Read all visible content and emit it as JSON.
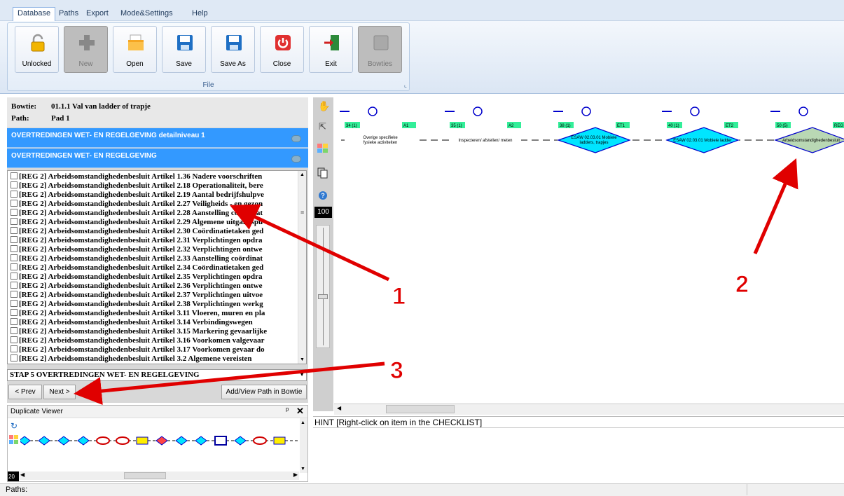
{
  "menu": {
    "tabs": [
      "Database",
      "Paths",
      "Export",
      "Mode&Settings",
      "Help"
    ]
  },
  "ribbon": {
    "buttons": [
      "Unlocked",
      "New",
      "Open",
      "Save",
      "Save As",
      "Close",
      "Exit",
      "Bowties"
    ],
    "group_label": "File"
  },
  "info": {
    "bowtie_label": "Bowtie:",
    "bowtie_value": "01.1.1 Val van ladder of trapje",
    "path_label": "Path:",
    "path_value": "Pad 1"
  },
  "bars": [
    "OVERTREDINGEN WET- EN REGELGEVING detailniveau 1",
    "OVERTREDINGEN WET- EN REGELGEVING"
  ],
  "checklist": {
    "items": [
      "[REG 2] Arbeidsomstandighedenbesluit Artikel 1.36 Nadere voorschriften",
      "[REG 2] Arbeidsomstandighedenbesluit Artikel 2.18 Operationaliteit, bere",
      "[REG 2] Arbeidsomstandighedenbesluit Artikel 2.19 Aantal bedrijfshulpve",
      "[REG 2] Arbeidsomstandighedenbesluit Artikel 2.27 Veiligheids - en gezon",
      "[REG 2] Arbeidsomstandighedenbesluit Artikel 2.28 Aanstelling coördinat",
      "[REG 2] Arbeidsomstandighedenbesluit Artikel 2.29 Algemene uitgangspu",
      "[REG 2] Arbeidsomstandighedenbesluit Artikel 2.30 Coördinatietaken ged",
      "[REG 2] Arbeidsomstandighedenbesluit Artikel 2.31 Verplichtingen opdra",
      "[REG 2] Arbeidsomstandighedenbesluit Artikel 2.32 Verplichtingen ontwe",
      "[REG 2] Arbeidsomstandighedenbesluit Artikel 2.33 Aanstelling coördinat",
      "[REG 2] Arbeidsomstandighedenbesluit Artikel 2.34 Coördinatietaken ged",
      "[REG 2] Arbeidsomstandighedenbesluit Artikel 2.35 Verplichtingen opdra",
      "[REG 2] Arbeidsomstandighedenbesluit Artikel 2.36 Verplichtingen ontwe",
      "[REG 2] Arbeidsomstandighedenbesluit Artikel 2.37 Verplichtingen uitvoe",
      "[REG 2] Arbeidsomstandighedenbesluit Artikel 2.38 Verplichtingen werkg",
      "[REG 2] Arbeidsomstandighedenbesluit Artikel 3.11 Vloeren, muren en pla",
      "[REG 2] Arbeidsomstandighedenbesluit Artikel 3.14 Verbindingswegen",
      "[REG 2] Arbeidsomstandighedenbesluit Artikel 3.15 Markering gevaarlijke",
      "[REG 2] Arbeidsomstandighedenbesluit Artikel 3.16 Voorkomen valgevaar",
      "[REG 2] Arbeidsomstandighedenbesluit Artikel 3.17 Voorkomen gevaar do",
      "[REG 2] Arbeidsomstandighedenbesluit Artikel 3.2 Algemene vereisten"
    ]
  },
  "step": "STAP 5 OVERTREDINGEN WET- EN REGELGEVING",
  "nav": {
    "prev": "< Prev",
    "next": "Next >",
    "add_view": "Add/View Path in Bowtie"
  },
  "duplicate_viewer": {
    "title": "Duplicate Viewer",
    "pin": "ᵖ",
    "close": "✕",
    "zoom": "20"
  },
  "tools": {
    "zoom": "100"
  },
  "nodes": [
    {
      "count": "34 (1)",
      "code": "A1",
      "text": "Overige specifieke fysieke activiteiten",
      "shape": "rect"
    },
    {
      "count": "35 (1)",
      "code": "A2",
      "text": "Inspecteren/ afstellen/ meten",
      "shape": "rect"
    },
    {
      "count": "38 (1)",
      "code": "ET1",
      "text": "ESAW 02.03.01 Mobiele ladders, trapjes",
      "shape": "diamond"
    },
    {
      "count": "40 (1)",
      "code": "ET2",
      "text": "ESAW 02.03.01 Mobiele ladder",
      "shape": "diamond"
    },
    {
      "count": "50 (5)",
      "code": "REG 1",
      "text": "Arbeidsomstandighedenbesluit",
      "shape": "diamond-gray"
    }
  ],
  "annotations": [
    "1",
    "2",
    "3"
  ],
  "hint": "HINT [Right-click on item in the CHECKLIST]",
  "status": "Paths:",
  "colors": {
    "accent": "#3399ff",
    "node_cyan": "#00e5ff",
    "node_gray": "#b9d8b4",
    "arrow": "#e00000"
  }
}
